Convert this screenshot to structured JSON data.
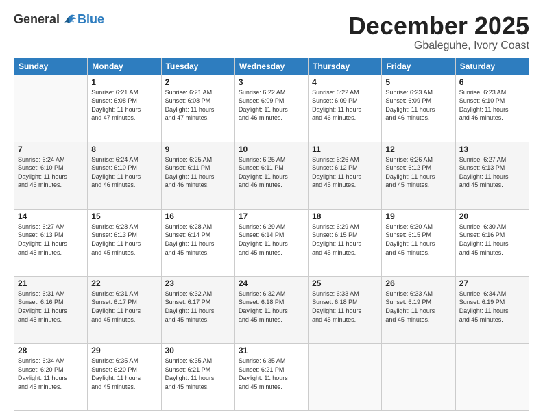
{
  "logo": {
    "general": "General",
    "blue": "Blue"
  },
  "header": {
    "month": "December 2025",
    "location": "Gbaleguhe, Ivory Coast"
  },
  "weekdays": [
    "Sunday",
    "Monday",
    "Tuesday",
    "Wednesday",
    "Thursday",
    "Friday",
    "Saturday"
  ],
  "weeks": [
    [
      {
        "day": "",
        "info": ""
      },
      {
        "day": "1",
        "info": "Sunrise: 6:21 AM\nSunset: 6:08 PM\nDaylight: 11 hours\nand 47 minutes."
      },
      {
        "day": "2",
        "info": "Sunrise: 6:21 AM\nSunset: 6:08 PM\nDaylight: 11 hours\nand 47 minutes."
      },
      {
        "day": "3",
        "info": "Sunrise: 6:22 AM\nSunset: 6:09 PM\nDaylight: 11 hours\nand 46 minutes."
      },
      {
        "day": "4",
        "info": "Sunrise: 6:22 AM\nSunset: 6:09 PM\nDaylight: 11 hours\nand 46 minutes."
      },
      {
        "day": "5",
        "info": "Sunrise: 6:23 AM\nSunset: 6:09 PM\nDaylight: 11 hours\nand 46 minutes."
      },
      {
        "day": "6",
        "info": "Sunrise: 6:23 AM\nSunset: 6:10 PM\nDaylight: 11 hours\nand 46 minutes."
      }
    ],
    [
      {
        "day": "7",
        "info": "Sunrise: 6:24 AM\nSunset: 6:10 PM\nDaylight: 11 hours\nand 46 minutes."
      },
      {
        "day": "8",
        "info": "Sunrise: 6:24 AM\nSunset: 6:10 PM\nDaylight: 11 hours\nand 46 minutes."
      },
      {
        "day": "9",
        "info": "Sunrise: 6:25 AM\nSunset: 6:11 PM\nDaylight: 11 hours\nand 46 minutes."
      },
      {
        "day": "10",
        "info": "Sunrise: 6:25 AM\nSunset: 6:11 PM\nDaylight: 11 hours\nand 46 minutes."
      },
      {
        "day": "11",
        "info": "Sunrise: 6:26 AM\nSunset: 6:12 PM\nDaylight: 11 hours\nand 45 minutes."
      },
      {
        "day": "12",
        "info": "Sunrise: 6:26 AM\nSunset: 6:12 PM\nDaylight: 11 hours\nand 45 minutes."
      },
      {
        "day": "13",
        "info": "Sunrise: 6:27 AM\nSunset: 6:13 PM\nDaylight: 11 hours\nand 45 minutes."
      }
    ],
    [
      {
        "day": "14",
        "info": "Sunrise: 6:27 AM\nSunset: 6:13 PM\nDaylight: 11 hours\nand 45 minutes."
      },
      {
        "day": "15",
        "info": "Sunrise: 6:28 AM\nSunset: 6:13 PM\nDaylight: 11 hours\nand 45 minutes."
      },
      {
        "day": "16",
        "info": "Sunrise: 6:28 AM\nSunset: 6:14 PM\nDaylight: 11 hours\nand 45 minutes."
      },
      {
        "day": "17",
        "info": "Sunrise: 6:29 AM\nSunset: 6:14 PM\nDaylight: 11 hours\nand 45 minutes."
      },
      {
        "day": "18",
        "info": "Sunrise: 6:29 AM\nSunset: 6:15 PM\nDaylight: 11 hours\nand 45 minutes."
      },
      {
        "day": "19",
        "info": "Sunrise: 6:30 AM\nSunset: 6:15 PM\nDaylight: 11 hours\nand 45 minutes."
      },
      {
        "day": "20",
        "info": "Sunrise: 6:30 AM\nSunset: 6:16 PM\nDaylight: 11 hours\nand 45 minutes."
      }
    ],
    [
      {
        "day": "21",
        "info": "Sunrise: 6:31 AM\nSunset: 6:16 PM\nDaylight: 11 hours\nand 45 minutes."
      },
      {
        "day": "22",
        "info": "Sunrise: 6:31 AM\nSunset: 6:17 PM\nDaylight: 11 hours\nand 45 minutes."
      },
      {
        "day": "23",
        "info": "Sunrise: 6:32 AM\nSunset: 6:17 PM\nDaylight: 11 hours\nand 45 minutes."
      },
      {
        "day": "24",
        "info": "Sunrise: 6:32 AM\nSunset: 6:18 PM\nDaylight: 11 hours\nand 45 minutes."
      },
      {
        "day": "25",
        "info": "Sunrise: 6:33 AM\nSunset: 6:18 PM\nDaylight: 11 hours\nand 45 minutes."
      },
      {
        "day": "26",
        "info": "Sunrise: 6:33 AM\nSunset: 6:19 PM\nDaylight: 11 hours\nand 45 minutes."
      },
      {
        "day": "27",
        "info": "Sunrise: 6:34 AM\nSunset: 6:19 PM\nDaylight: 11 hours\nand 45 minutes."
      }
    ],
    [
      {
        "day": "28",
        "info": "Sunrise: 6:34 AM\nSunset: 6:20 PM\nDaylight: 11 hours\nand 45 minutes."
      },
      {
        "day": "29",
        "info": "Sunrise: 6:35 AM\nSunset: 6:20 PM\nDaylight: 11 hours\nand 45 minutes."
      },
      {
        "day": "30",
        "info": "Sunrise: 6:35 AM\nSunset: 6:21 PM\nDaylight: 11 hours\nand 45 minutes."
      },
      {
        "day": "31",
        "info": "Sunrise: 6:35 AM\nSunset: 6:21 PM\nDaylight: 11 hours\nand 45 minutes."
      },
      {
        "day": "",
        "info": ""
      },
      {
        "day": "",
        "info": ""
      },
      {
        "day": "",
        "info": ""
      }
    ]
  ]
}
